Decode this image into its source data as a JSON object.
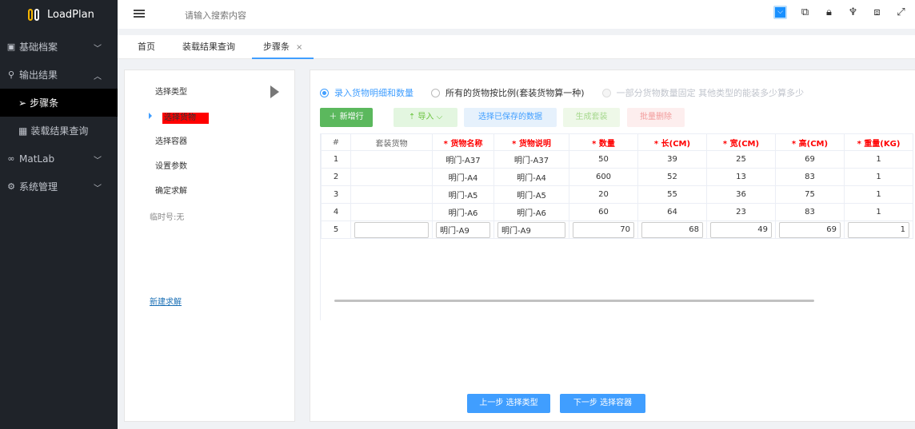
{
  "app": {
    "name": "LoadPlan"
  },
  "sidebar": {
    "items": [
      {
        "label": "基础档案",
        "icon": "image-icon",
        "expanded": false
      },
      {
        "label": "输出结果",
        "icon": "pin-icon",
        "expanded": true,
        "children": [
          {
            "label": "步骤条",
            "icon": "send-icon",
            "active": true
          },
          {
            "label": "装载结果查询",
            "icon": "grid-icon",
            "active": false
          }
        ]
      },
      {
        "label": "MatLab",
        "icon": "glasses-icon",
        "expanded": false
      },
      {
        "label": "系统管理",
        "icon": "gear-icon",
        "expanded": false
      }
    ]
  },
  "header": {
    "search_placeholder": "请输入搜索内容"
  },
  "tabs": [
    {
      "label": "首页",
      "active": false
    },
    {
      "label": "装载结果查询",
      "active": false
    },
    {
      "label": "步骤条",
      "active": true,
      "closable": true,
      "close": "×"
    }
  ],
  "steps": {
    "items": [
      "选择类型",
      "选择货物",
      "选择容器",
      "设置参数",
      "确定求解"
    ],
    "current_index": 1,
    "temp_no": "临时号:无",
    "new_solve": "新建求解"
  },
  "main": {
    "radios": [
      {
        "label": "录入货物明细和数量",
        "checked": true,
        "disabled": false
      },
      {
        "label": "所有的货物按比例(套装货物算一种)",
        "checked": false,
        "disabled": false
      },
      {
        "label": "一部分货物数量固定 其他类型的能装多少算多少",
        "checked": false,
        "disabled": true
      }
    ],
    "buttons": {
      "add": "＋ 新增行",
      "import": "⇡ 导入 ⌵",
      "saved": "选择已保存的数据",
      "generate": "生成套装",
      "delete": "批量删除"
    },
    "table": {
      "columns": [
        {
          "label": "#",
          "required": false
        },
        {
          "label": "套装货物",
          "required": false
        },
        {
          "label": "* 货物名称",
          "required": true
        },
        {
          "label": "* 货物说明",
          "required": true
        },
        {
          "label": "* 数量",
          "required": true
        },
        {
          "label": "* 长(CM)",
          "required": true
        },
        {
          "label": "* 宽(CM)",
          "required": true
        },
        {
          "label": "* 高(CM)",
          "required": true
        },
        {
          "label": "* 重量(KG)",
          "required": true
        }
      ],
      "rows": [
        [
          "1",
          "",
          "明门-A37",
          "明门-A37",
          "50",
          "39",
          "25",
          "69",
          "1"
        ],
        [
          "2",
          "",
          "明门-A4",
          "明门-A4",
          "600",
          "52",
          "13",
          "83",
          "1"
        ],
        [
          "3",
          "",
          "明门-A5",
          "明门-A5",
          "20",
          "55",
          "36",
          "75",
          "1"
        ],
        [
          "4",
          "",
          "明门-A6",
          "明门-A6",
          "60",
          "64",
          "23",
          "83",
          "1"
        ]
      ],
      "edit_row": {
        "index": "5",
        "suit": "",
        "name": "明门-A9",
        "desc": "明门-A9",
        "qty": "70",
        "len": "68",
        "wid": "49",
        "hei": "69",
        "wt": "1"
      }
    },
    "prev_button": "上一步 选择类型",
    "next_button": "下一步 选择容器"
  }
}
